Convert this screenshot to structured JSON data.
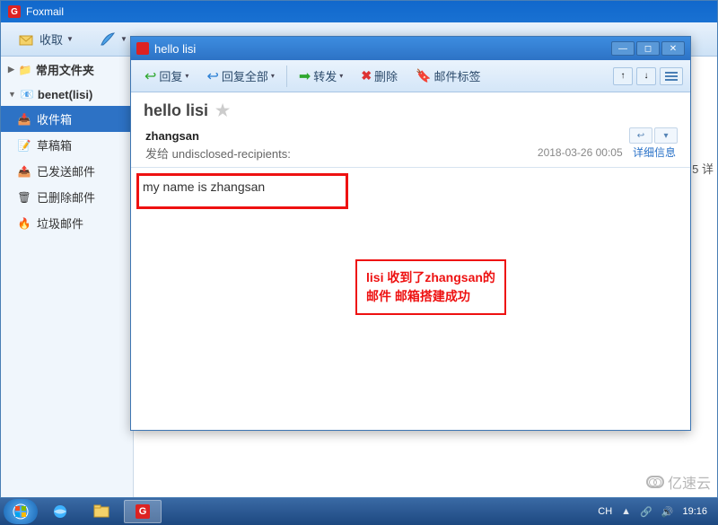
{
  "app": {
    "title": "Foxmail"
  },
  "main_toolbar": {
    "receive": "收取",
    "compose_icon": "compose"
  },
  "sidebar": {
    "folders": [
      {
        "label": "常用文件夹"
      },
      {
        "label": "benet(lisi)"
      }
    ],
    "items": [
      {
        "label": "收件箱",
        "active": true
      },
      {
        "label": "草稿箱"
      },
      {
        "label": "已发送邮件"
      },
      {
        "label": "已删除邮件"
      },
      {
        "label": "垃圾邮件"
      }
    ]
  },
  "right_strip": {
    "cut": "5  详"
  },
  "msg": {
    "title": "hello lisi",
    "subject": "hello lisi",
    "toolbar": {
      "reply": "回复",
      "reply_all": "回复全部",
      "forward": "转发",
      "delete": "删除",
      "tags": "邮件标签"
    },
    "sender": "zhangsan",
    "recipients_label": "发给 undisclosed-recipients:",
    "timestamp": "2018-03-26 00:05",
    "detail": "详细信息",
    "body": "my name is zhangsan"
  },
  "annotation": {
    "line1": "lisi 收到了zhangsan的",
    "line2": "邮件  邮箱搭建成功"
  },
  "taskbar": {
    "ime": "CH",
    "clock": "19:16"
  },
  "watermark": "亿速云"
}
